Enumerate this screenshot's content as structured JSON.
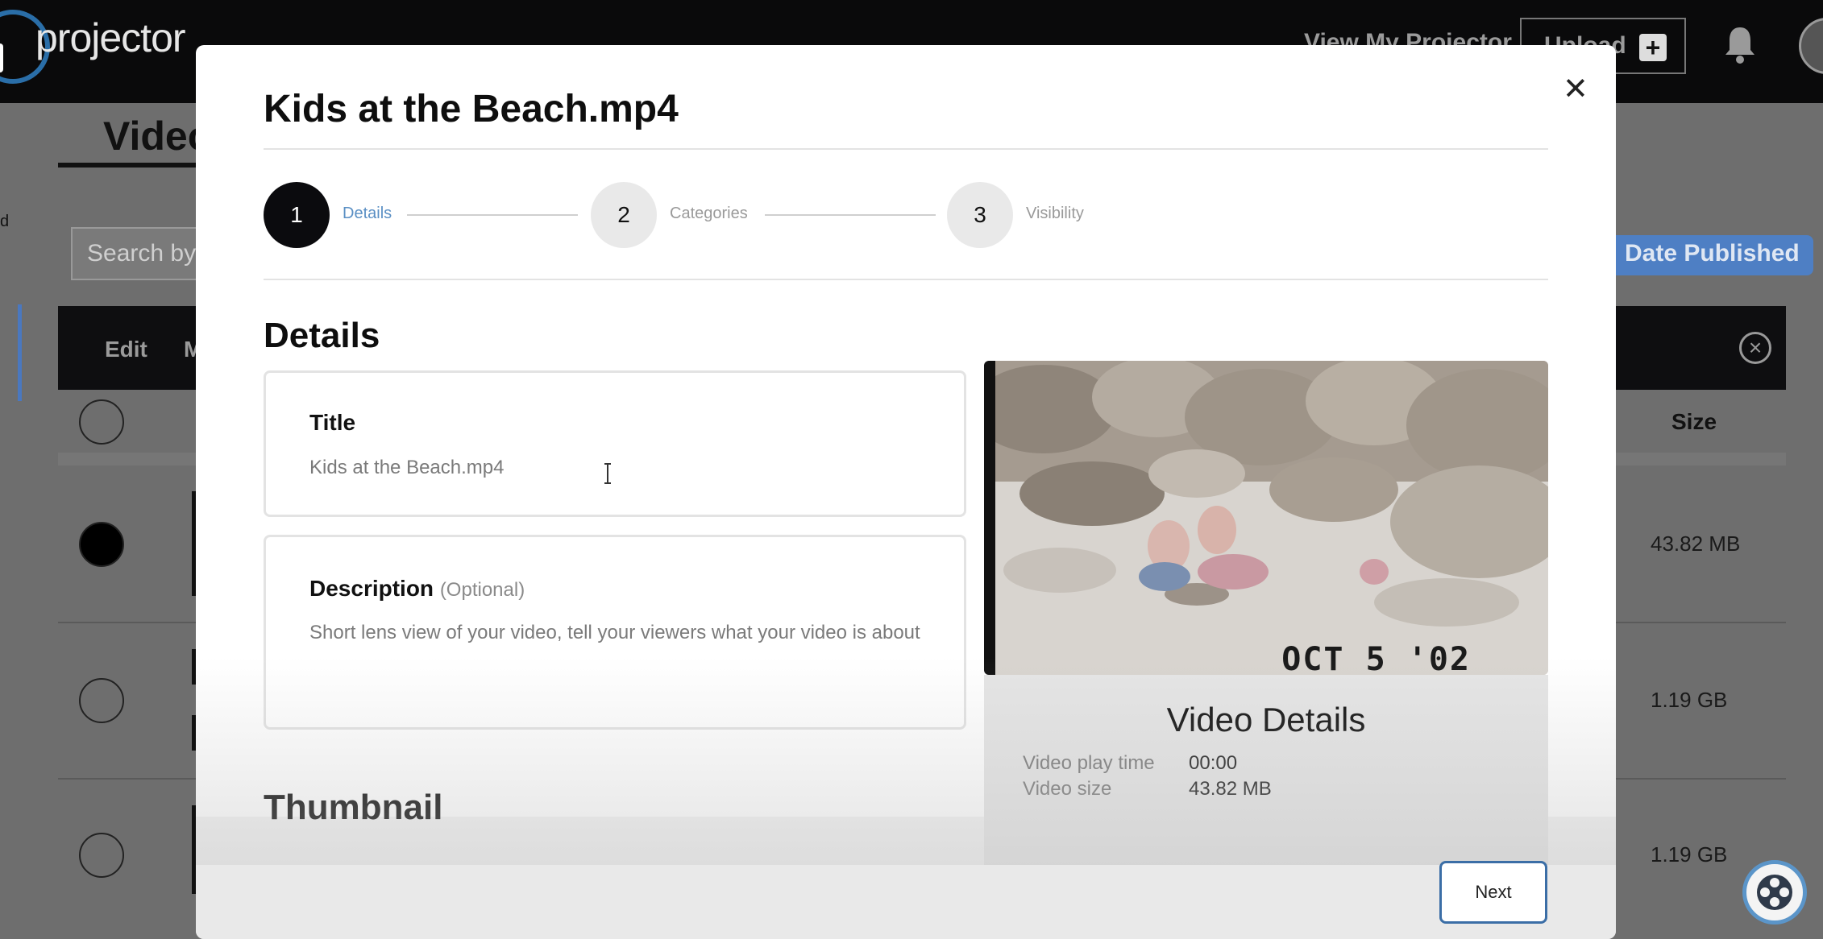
{
  "app": {
    "logo_text": "projector",
    "nav_link": "View My Projector",
    "upload_label": "Upload"
  },
  "background": {
    "tab": "Video",
    "search_placeholder": "Search by",
    "sort_label": "Date Published",
    "table_headers": {
      "edit": "Edit",
      "m": "M",
      "size": "Size"
    },
    "rows": [
      {
        "size": "43.82 MB",
        "selected": true
      },
      {
        "size": "1.19 GB",
        "selected": false
      },
      {
        "size": "1.19 GB",
        "selected": false
      }
    ]
  },
  "modal": {
    "title": "Kids at the Beach.mp4",
    "steps": [
      {
        "number": "1",
        "label": "Details",
        "active": true
      },
      {
        "number": "2",
        "label": "Categories",
        "active": false
      },
      {
        "number": "3",
        "label": "Visibility",
        "active": false
      }
    ],
    "section_title": "Details",
    "title_field": {
      "label": "Title",
      "value": "Kids at the Beach.mp4"
    },
    "description_field": {
      "label": "Description",
      "optional": "(Optional)",
      "placeholder": "Short lens view of your video, tell your viewers what your video is about"
    },
    "thumbnail_title": "Thumbnail",
    "preview_datestamp": "OCT  5 '02",
    "video_details": {
      "title": "Video Details",
      "play_time_label": "Video play time",
      "play_time": "00:00",
      "size_label": "Video size",
      "size": "43.82 MB"
    },
    "next_label": "Next"
  },
  "colors": {
    "accent": "#3b6ea6",
    "step_active": "#0b0b0e",
    "link_blue": "#5a8fc4"
  }
}
